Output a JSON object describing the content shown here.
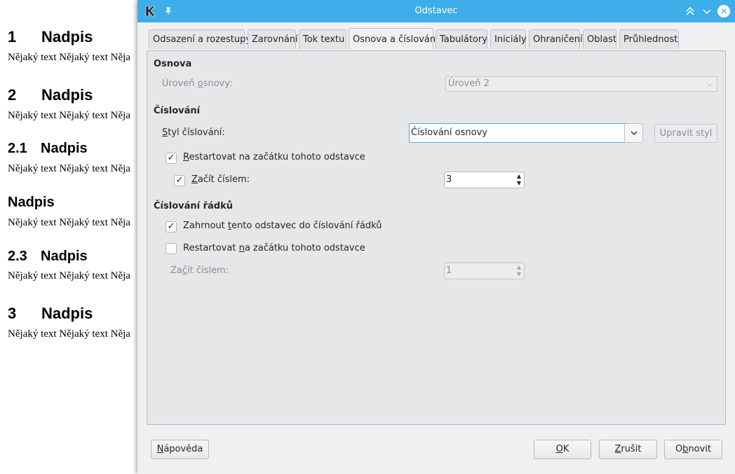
{
  "document": {
    "sections": [
      {
        "number": "1",
        "heading": "Nadpis",
        "text": "Nějaký text Nějaký text Něja"
      },
      {
        "number": "2",
        "heading": "Nadpis",
        "text": "Nějaký text Nějaký text Něja"
      },
      {
        "number": "2.1",
        "heading": "Nadpis",
        "text": "Nějaký text Nějaký text Něja"
      },
      {
        "number": "",
        "heading": "Nadpis",
        "text": "Nějaký text Nějaký text Něja"
      },
      {
        "number": "2.3",
        "heading": "Nadpis",
        "text": "Nějaký text Nějaký text Něja"
      },
      {
        "number": "3",
        "heading": "Nadpis",
        "text": "Nějaký text Nějaký text Něja"
      }
    ]
  },
  "dialog": {
    "title": "Odstavec",
    "tabs": [
      {
        "label": "Odsazení a rozestupy"
      },
      {
        "label": "Zarovnání"
      },
      {
        "label": "Tok textu"
      },
      {
        "label": "Osnova a číslování",
        "active": true
      },
      {
        "label": "Tabulátory"
      },
      {
        "label": "Iniciály"
      },
      {
        "label": "Ohraničení"
      },
      {
        "label": "Oblast"
      },
      {
        "label": "Průhlednost"
      }
    ],
    "outline": {
      "title": "Osnova",
      "level_label_pre": "Úroveň ",
      "level_label_u": "o",
      "level_label_post": "snovy:",
      "level_value": "Úroveň 2"
    },
    "numbering": {
      "title": "Číslování",
      "style_label_u": "S",
      "style_label_post": "tyl číslování:",
      "style_value": "Číslování osnovy",
      "edit_style_label": "Upravit styl",
      "restart_label_u": "R",
      "restart_label_post": "estartovat na začátku tohoto odstavce",
      "restart_checked": true,
      "start_at_label_u": "Z",
      "start_at_label_post": "ačít číslem:",
      "start_at_checked": true,
      "start_at_value": "3"
    },
    "line_numbering": {
      "title": "Číslování řádků",
      "include_label_pre": "Zahrnout ",
      "include_label_u": "t",
      "include_label_post": "ento odstavec do číslování řádků",
      "include_checked": true,
      "restart_label_pre": "Restartovat ",
      "restart_label_u": "n",
      "restart_label_post": "a začátku tohoto odstavce",
      "restart_checked": false,
      "start_at_label_pre": "Za",
      "start_at_label_u": "č",
      "start_at_label_post": "ít číslem:",
      "start_at_value": "1"
    },
    "buttons": {
      "help_u": "N",
      "help_post": "ápověda",
      "ok_u": "O",
      "ok_post": "K",
      "cancel_u": "Z",
      "cancel_post": "rušit",
      "reset_pre": "O",
      "reset_u": "b",
      "reset_post": "novit"
    }
  }
}
